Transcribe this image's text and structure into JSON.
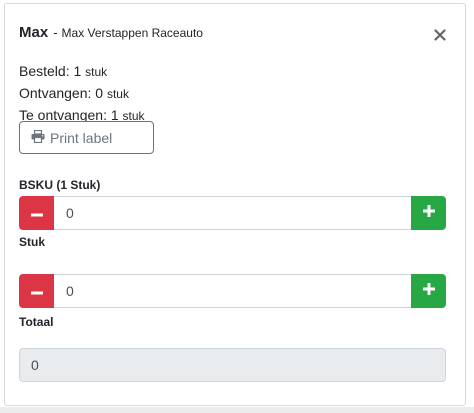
{
  "header": {
    "title": "Max",
    "separator": "-",
    "subtitle": "Max Verstappen Raceauto"
  },
  "stats": {
    "ordered_label": "Besteld: 1",
    "ordered_unit": "stuk",
    "received_label": "Ontvangen: 0",
    "received_unit": "stuk",
    "to_receive_label": "Te ontvangen: 1",
    "to_receive_unit": "stuk"
  },
  "print_button": {
    "label": "Print label",
    "icon": "printer-icon"
  },
  "bsku": {
    "label": "BSKU (1 Stuk)",
    "value": "0"
  },
  "stuk": {
    "label": "Stuk",
    "value": "0"
  },
  "total": {
    "label": "Totaal",
    "value": "0"
  },
  "colors": {
    "minus": "#dc3545",
    "plus": "#28a745",
    "readonly_bg": "#e9ecef",
    "outline_button": "#6c757d"
  }
}
